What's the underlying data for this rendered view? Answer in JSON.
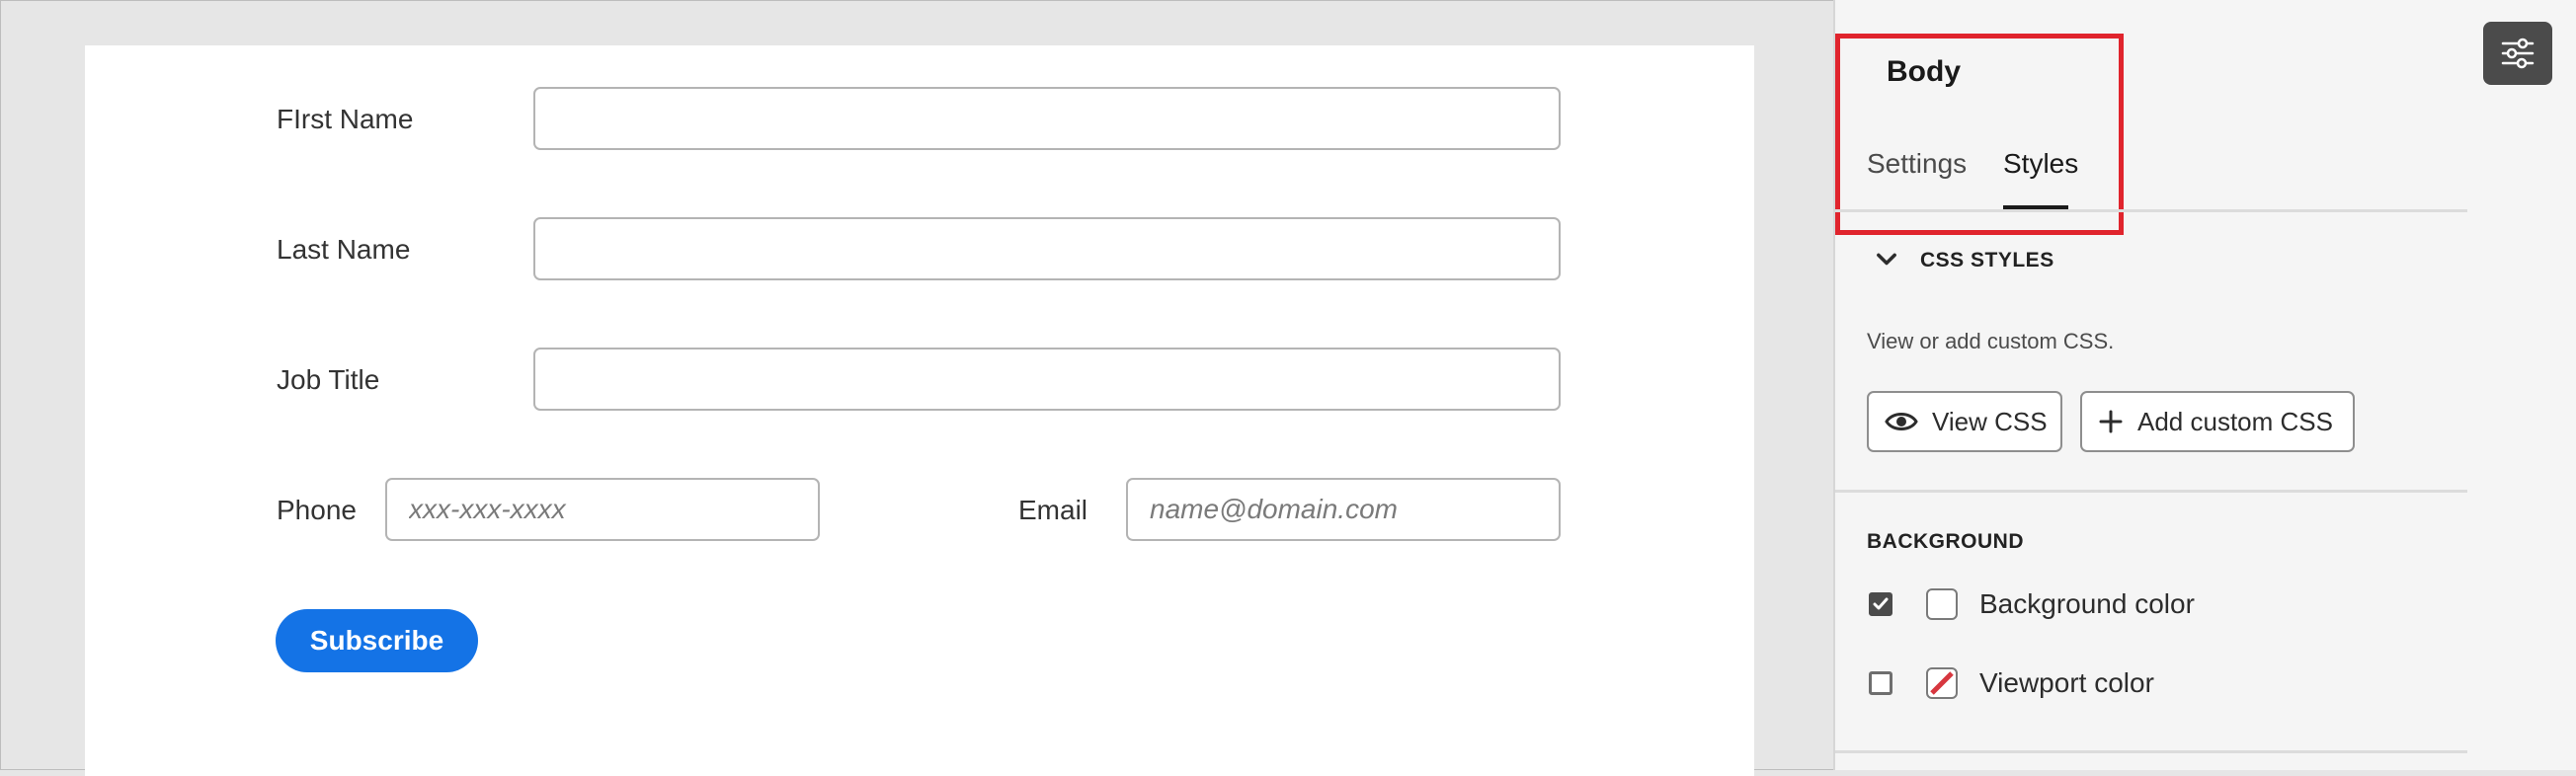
{
  "form": {
    "first_name_label": "FIrst Name",
    "last_name_label": "Last Name",
    "job_title_label": "Job Title",
    "phone_label": "Phone",
    "phone_placeholder": "xxx-xxx-xxxx",
    "email_label": "Email",
    "email_placeholder": "name@domain.com",
    "subscribe_label": "Subscribe"
  },
  "panel": {
    "title": "Body",
    "tabs": [
      {
        "label": "Settings",
        "active": false
      },
      {
        "label": "Styles",
        "active": true
      }
    ],
    "css_styles": {
      "heading": "CSS STYLES",
      "description": "View or add custom CSS.",
      "view_css_label": "View CSS",
      "add_css_label": "Add custom CSS"
    },
    "background": {
      "heading": "BACKGROUND",
      "background_color_label": "Background color",
      "background_color_checked": true,
      "viewport_color_label": "Viewport color",
      "viewport_color_checked": false
    }
  },
  "colors": {
    "accent": "#1473e6",
    "highlight": "#e0242d",
    "swatch_none": "#d7373f"
  },
  "icons": {
    "rail_button": "properties-sliders-icon",
    "view_css": "eye-icon",
    "add_css": "plus-icon",
    "collapse": "chevron-down-icon"
  }
}
